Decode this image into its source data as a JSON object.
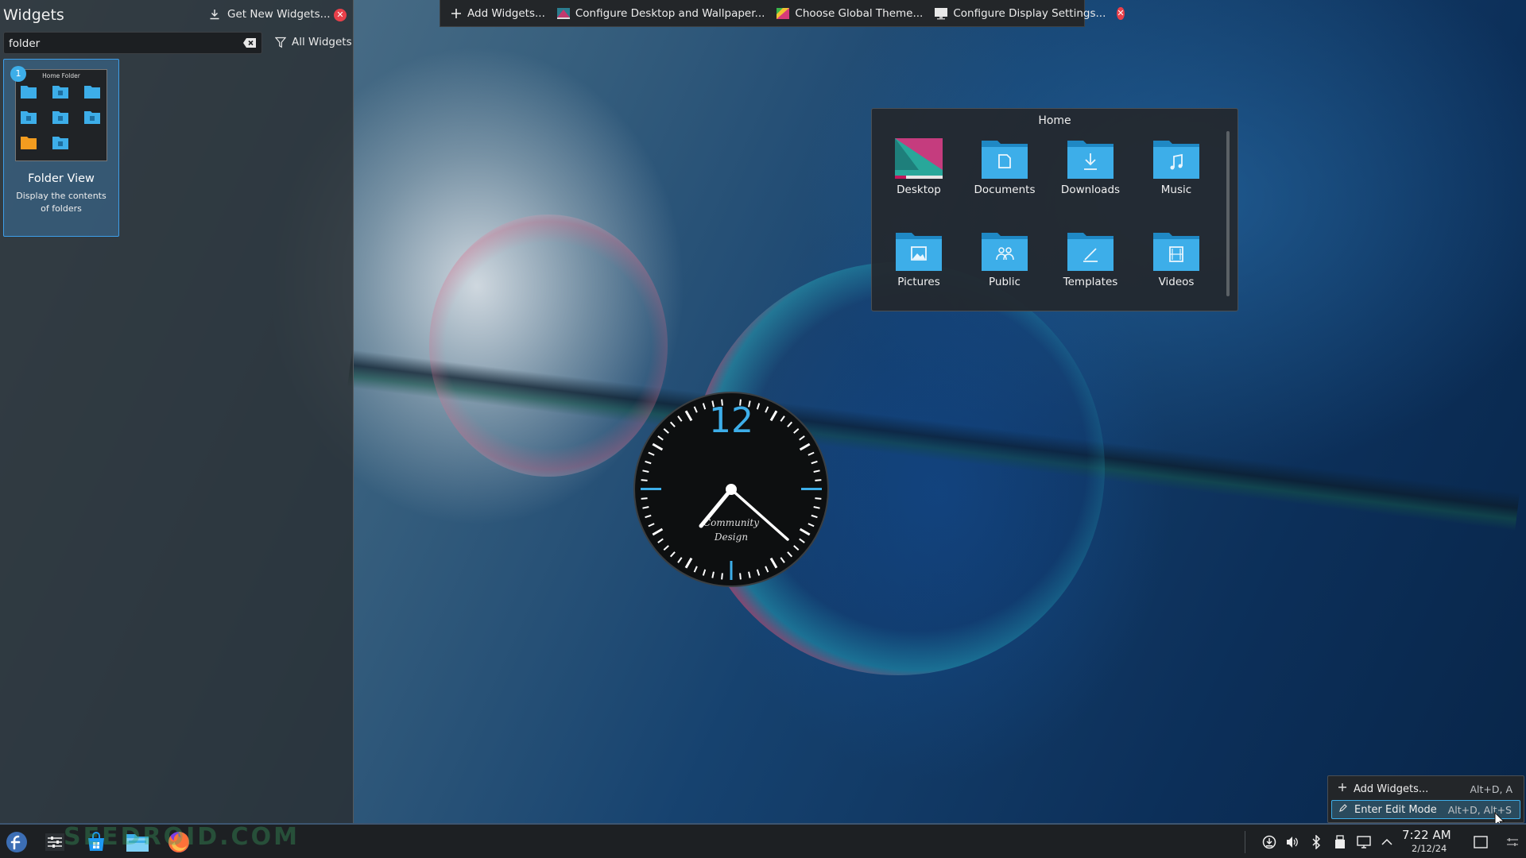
{
  "widgets_panel": {
    "title": "Widgets",
    "get_new_label": "Get New Widgets...",
    "search_value": "folder",
    "filter_label": "All Widgets",
    "card": {
      "badge": "1",
      "preview_title": "Home Folder",
      "name": "Folder View",
      "description": "Display the contents of folders"
    }
  },
  "edit_toolbar": {
    "items": [
      {
        "label": "Add Widgets...",
        "icon": "plus-icon"
      },
      {
        "label": "Configure Desktop and Wallpaper...",
        "icon": "wallpaper-icon"
      },
      {
        "label": "Choose Global Theme...",
        "icon": "theme-icon"
      },
      {
        "label": "Configure Display Settings...",
        "icon": "display-icon"
      }
    ]
  },
  "folder_view": {
    "title": "Home",
    "items": [
      {
        "label": "Desktop",
        "icon": "desktop-folder-icon"
      },
      {
        "label": "Documents",
        "icon": "documents-folder-icon"
      },
      {
        "label": "Downloads",
        "icon": "downloads-folder-icon"
      },
      {
        "label": "Music",
        "icon": "music-folder-icon"
      },
      {
        "label": "Pictures",
        "icon": "pictures-folder-icon"
      },
      {
        "label": "Public",
        "icon": "public-folder-icon"
      },
      {
        "label": "Templates",
        "icon": "templates-folder-icon"
      },
      {
        "label": "Videos",
        "icon": "videos-folder-icon"
      }
    ]
  },
  "analog_clock": {
    "numeral": "12",
    "brand_line1": "Community",
    "brand_line2": "Design"
  },
  "context_menu": {
    "items": [
      {
        "label": "Add Widgets...",
        "shortcut": "Alt+D, A",
        "icon": "plus-icon"
      },
      {
        "label": "Enter Edit Mode",
        "shortcut": "Alt+D, Alt+S",
        "icon": "pencil-icon"
      }
    ]
  },
  "taskbar": {
    "watermark": "SEEDROID.COM",
    "time": "7:22 AM",
    "date": "2/12/24"
  },
  "colors": {
    "accent": "#3daee9",
    "close_red": "#e9404a",
    "folder_blue": "#3daee9",
    "panel_bg": "#232629"
  }
}
